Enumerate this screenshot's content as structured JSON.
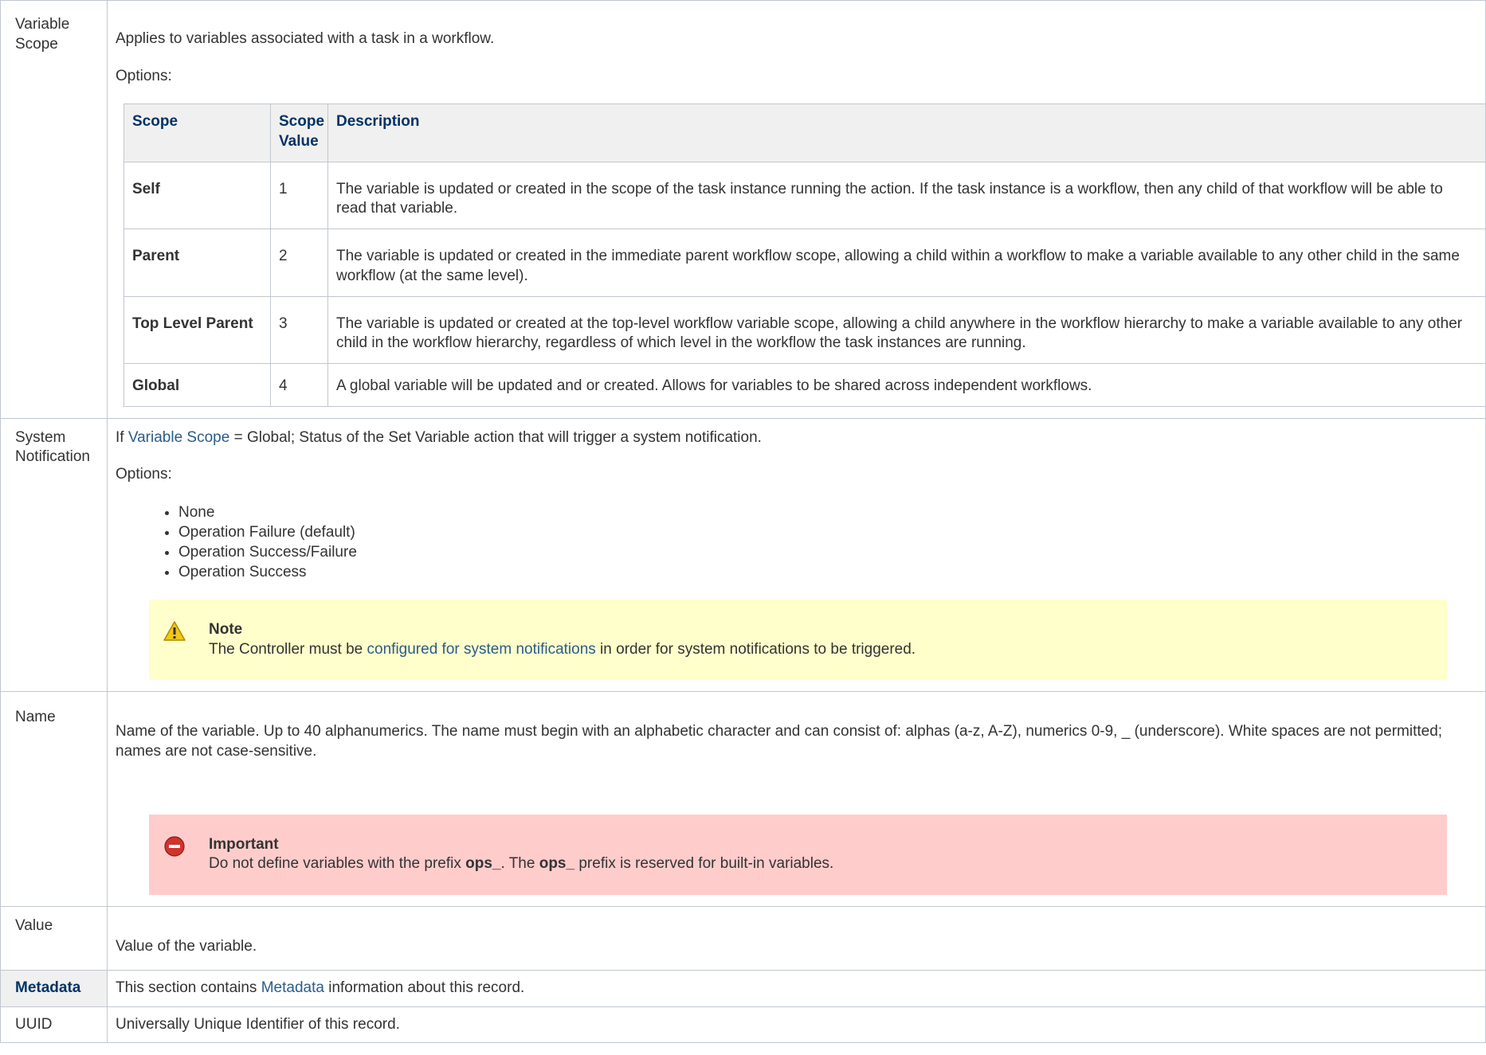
{
  "variable_scope": {
    "label": "Variable Scope",
    "description": "Applies to variables associated with a task in a workflow.",
    "options_label": "Options:",
    "table": {
      "headers": [
        "Scope",
        "Scope Value",
        "Description"
      ],
      "rows": [
        {
          "scope": "Self",
          "value": "1",
          "description": "The variable is updated or created in the scope of the task instance running the action. If the task instance is a workflow, then any child of that workflow will be able to read that variable."
        },
        {
          "scope": "Parent",
          "value": "2",
          "description": "The variable is updated or created in the immediate parent workflow scope, allowing a child within a workflow to make a variable available to any other child in the same workflow (at the same level)."
        },
        {
          "scope": "Top Level Parent",
          "value": "3",
          "description": "The variable is updated or created at the top-level workflow variable scope, allowing a child anywhere in the workflow hierarchy to make a variable available to any other child in the workflow hierarchy, regardless of which level in the workflow the task instances are running."
        },
        {
          "scope": "Global",
          "value": "4",
          "description": "A global variable will be updated and or created. Allows for variables to be shared across independent workflows."
        }
      ]
    }
  },
  "system_notification": {
    "label": "System Notification",
    "desc_prefix": "If ",
    "desc_link": "Variable Scope",
    "desc_suffix": " = Global; Status of the Set Variable action that will trigger a system notification.",
    "options_label": "Options:",
    "options": [
      "None",
      "Operation Failure (default)",
      "Operation Success/Failure",
      "Operation Success"
    ],
    "note": {
      "title": "Note",
      "text_prefix": "The Controller must be ",
      "link": "configured for system notifications",
      "text_suffix": " in order for system notifications to be triggered."
    }
  },
  "name": {
    "label": "Name",
    "description": "Name of the variable. Up to 40 alphanumerics. The name must begin with an alphabetic character and can consist of: alphas (a-z, A-Z), numerics 0-9, _ (underscore). White spaces are not permitted; names are not case-sensitive.",
    "important": {
      "title": "Important",
      "text_1": "Do not define variables with the prefix ",
      "bold_1": "ops_",
      "text_2": ". The ",
      "bold_2": "ops_",
      "text_3": " prefix is reserved for built-in variables."
    }
  },
  "value": {
    "label": "Value",
    "description": "Value of the variable."
  },
  "metadata": {
    "label": "Metadata",
    "desc_prefix": "This section contains ",
    "desc_link": "Metadata",
    "desc_suffix": " information about this record."
  },
  "uuid": {
    "label": "UUID",
    "description": "Universally Unique Identifier of this record."
  },
  "colors": {
    "link": "#2a5c8a",
    "header_text": "#003366",
    "header_bg": "#f0f0f0",
    "note_bg": "#ffffcc",
    "important_bg": "#ffcccc"
  },
  "icons": {
    "note": "warning-icon",
    "important": "stop-icon"
  }
}
